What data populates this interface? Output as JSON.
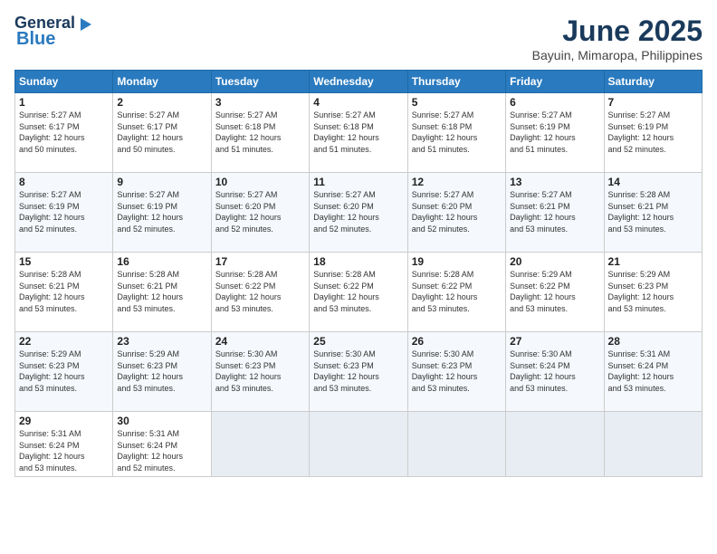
{
  "header": {
    "logo_line1": "General",
    "logo_line2": "Blue",
    "month": "June 2025",
    "location": "Bayuin, Mimaropa, Philippines"
  },
  "weekdays": [
    "Sunday",
    "Monday",
    "Tuesday",
    "Wednesday",
    "Thursday",
    "Friday",
    "Saturday"
  ],
  "weeks": [
    [
      {
        "day": "1",
        "info": "Sunrise: 5:27 AM\nSunset: 6:17 PM\nDaylight: 12 hours\nand 50 minutes."
      },
      {
        "day": "2",
        "info": "Sunrise: 5:27 AM\nSunset: 6:17 PM\nDaylight: 12 hours\nand 50 minutes."
      },
      {
        "day": "3",
        "info": "Sunrise: 5:27 AM\nSunset: 6:18 PM\nDaylight: 12 hours\nand 51 minutes."
      },
      {
        "day": "4",
        "info": "Sunrise: 5:27 AM\nSunset: 6:18 PM\nDaylight: 12 hours\nand 51 minutes."
      },
      {
        "day": "5",
        "info": "Sunrise: 5:27 AM\nSunset: 6:18 PM\nDaylight: 12 hours\nand 51 minutes."
      },
      {
        "day": "6",
        "info": "Sunrise: 5:27 AM\nSunset: 6:19 PM\nDaylight: 12 hours\nand 51 minutes."
      },
      {
        "day": "7",
        "info": "Sunrise: 5:27 AM\nSunset: 6:19 PM\nDaylight: 12 hours\nand 52 minutes."
      }
    ],
    [
      {
        "day": "8",
        "info": "Sunrise: 5:27 AM\nSunset: 6:19 PM\nDaylight: 12 hours\nand 52 minutes."
      },
      {
        "day": "9",
        "info": "Sunrise: 5:27 AM\nSunset: 6:19 PM\nDaylight: 12 hours\nand 52 minutes."
      },
      {
        "day": "10",
        "info": "Sunrise: 5:27 AM\nSunset: 6:20 PM\nDaylight: 12 hours\nand 52 minutes."
      },
      {
        "day": "11",
        "info": "Sunrise: 5:27 AM\nSunset: 6:20 PM\nDaylight: 12 hours\nand 52 minutes."
      },
      {
        "day": "12",
        "info": "Sunrise: 5:27 AM\nSunset: 6:20 PM\nDaylight: 12 hours\nand 52 minutes."
      },
      {
        "day": "13",
        "info": "Sunrise: 5:27 AM\nSunset: 6:21 PM\nDaylight: 12 hours\nand 53 minutes."
      },
      {
        "day": "14",
        "info": "Sunrise: 5:28 AM\nSunset: 6:21 PM\nDaylight: 12 hours\nand 53 minutes."
      }
    ],
    [
      {
        "day": "15",
        "info": "Sunrise: 5:28 AM\nSunset: 6:21 PM\nDaylight: 12 hours\nand 53 minutes."
      },
      {
        "day": "16",
        "info": "Sunrise: 5:28 AM\nSunset: 6:21 PM\nDaylight: 12 hours\nand 53 minutes."
      },
      {
        "day": "17",
        "info": "Sunrise: 5:28 AM\nSunset: 6:22 PM\nDaylight: 12 hours\nand 53 minutes."
      },
      {
        "day": "18",
        "info": "Sunrise: 5:28 AM\nSunset: 6:22 PM\nDaylight: 12 hours\nand 53 minutes."
      },
      {
        "day": "19",
        "info": "Sunrise: 5:28 AM\nSunset: 6:22 PM\nDaylight: 12 hours\nand 53 minutes."
      },
      {
        "day": "20",
        "info": "Sunrise: 5:29 AM\nSunset: 6:22 PM\nDaylight: 12 hours\nand 53 minutes."
      },
      {
        "day": "21",
        "info": "Sunrise: 5:29 AM\nSunset: 6:23 PM\nDaylight: 12 hours\nand 53 minutes."
      }
    ],
    [
      {
        "day": "22",
        "info": "Sunrise: 5:29 AM\nSunset: 6:23 PM\nDaylight: 12 hours\nand 53 minutes."
      },
      {
        "day": "23",
        "info": "Sunrise: 5:29 AM\nSunset: 6:23 PM\nDaylight: 12 hours\nand 53 minutes."
      },
      {
        "day": "24",
        "info": "Sunrise: 5:30 AM\nSunset: 6:23 PM\nDaylight: 12 hours\nand 53 minutes."
      },
      {
        "day": "25",
        "info": "Sunrise: 5:30 AM\nSunset: 6:23 PM\nDaylight: 12 hours\nand 53 minutes."
      },
      {
        "day": "26",
        "info": "Sunrise: 5:30 AM\nSunset: 6:23 PM\nDaylight: 12 hours\nand 53 minutes."
      },
      {
        "day": "27",
        "info": "Sunrise: 5:30 AM\nSunset: 6:24 PM\nDaylight: 12 hours\nand 53 minutes."
      },
      {
        "day": "28",
        "info": "Sunrise: 5:31 AM\nSunset: 6:24 PM\nDaylight: 12 hours\nand 53 minutes."
      }
    ],
    [
      {
        "day": "29",
        "info": "Sunrise: 5:31 AM\nSunset: 6:24 PM\nDaylight: 12 hours\nand 53 minutes."
      },
      {
        "day": "30",
        "info": "Sunrise: 5:31 AM\nSunset: 6:24 PM\nDaylight: 12 hours\nand 52 minutes."
      },
      {
        "day": "",
        "info": ""
      },
      {
        "day": "",
        "info": ""
      },
      {
        "day": "",
        "info": ""
      },
      {
        "day": "",
        "info": ""
      },
      {
        "day": "",
        "info": ""
      }
    ]
  ]
}
